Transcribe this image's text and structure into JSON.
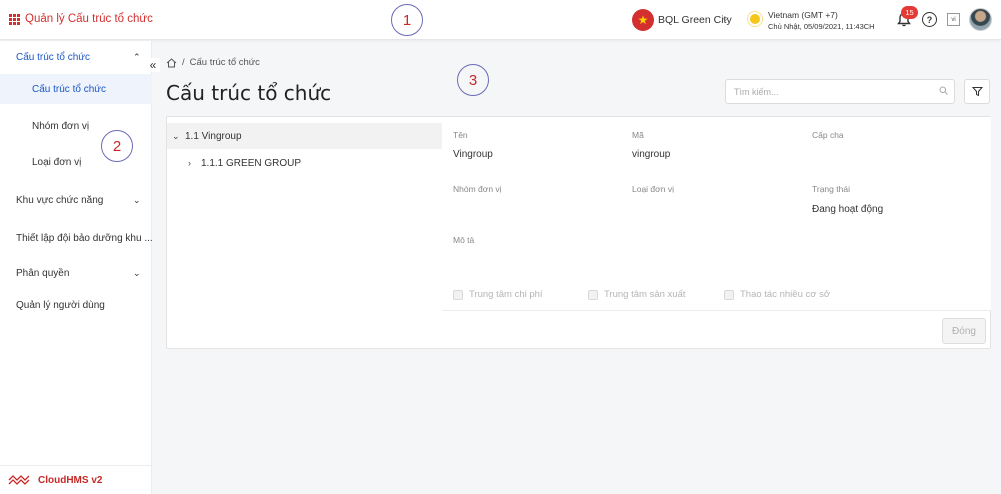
{
  "header": {
    "app_title": "Quản lý Cấu trúc tổ chức",
    "marker": "1",
    "org_name": "BQL Green City",
    "timezone": "Vietnam (GMT +7)",
    "datetime": "Chủ Nhật, 05/09/2021, 11:43CH",
    "notifications_count": "15",
    "help_symbol": "?",
    "lang_symbol": "vi"
  },
  "sidebar": {
    "marker": "2",
    "items": [
      {
        "label": "Cấu trúc tổ chức",
        "chevron": "up"
      },
      {
        "label": "Cấu trúc tổ chức"
      },
      {
        "label": "Nhóm đơn vị"
      },
      {
        "label": "Loại đơn vị"
      },
      {
        "label": "Khu vực chức năng",
        "chevron": "down"
      },
      {
        "label": "Thiết lập đội bảo dưỡng khu ..."
      },
      {
        "label": "Phân quyền",
        "chevron": "down"
      },
      {
        "label": "Quản lý người dùng"
      }
    ],
    "collapse_symbol": "«",
    "footer": "CloudHMS v2"
  },
  "main": {
    "marker": "3",
    "breadcrumb": "Cấu trúc tổ chức",
    "breadcrumb_sep": "/",
    "title": "Cấu trúc tổ chức",
    "search_placeholder": "Tìm kiếm...",
    "tree": [
      {
        "label": "1.1 Vingroup",
        "caret": "⌄"
      },
      {
        "label": "1.1.1 GREEN GROUP",
        "caret": "›"
      }
    ],
    "detail": {
      "name_label": "Tên",
      "name_value": "Vingroup",
      "code_label": "Mã",
      "code_value": "vingroup",
      "parent_label": "Cấp cha",
      "parent_value": "",
      "group_label": "Nhóm đơn vị",
      "group_value": "",
      "type_label": "Loại đơn vị",
      "type_value": "",
      "status_label": "Trạng thái",
      "status_value": "Đang hoạt động",
      "desc_label": "Mô tả",
      "desc_value": "",
      "checkboxes": [
        "Trung tâm chi phí",
        "Trung tâm sản xuất",
        "Thao tác nhiều cơ sở"
      ],
      "close_label": "Đóng"
    }
  },
  "colors": {
    "brand_red": "#d32f2f",
    "active_blue": "#1a56c4",
    "active_bg": "#eef3fc"
  }
}
